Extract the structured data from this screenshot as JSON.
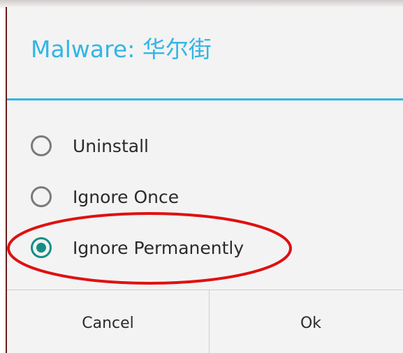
{
  "dialog": {
    "title": "Malware: 华尔街",
    "options": [
      {
        "label": "Uninstall",
        "checked": false
      },
      {
        "label": "Ignore Once",
        "checked": false
      },
      {
        "label": "Ignore Permanently",
        "checked": true
      }
    ],
    "buttons": {
      "cancel_label": "Cancel",
      "ok_label": "Ok"
    }
  },
  "colors": {
    "accent": "#33b5e5",
    "radio_checked": "#138f84",
    "annotation": "#e01010"
  }
}
